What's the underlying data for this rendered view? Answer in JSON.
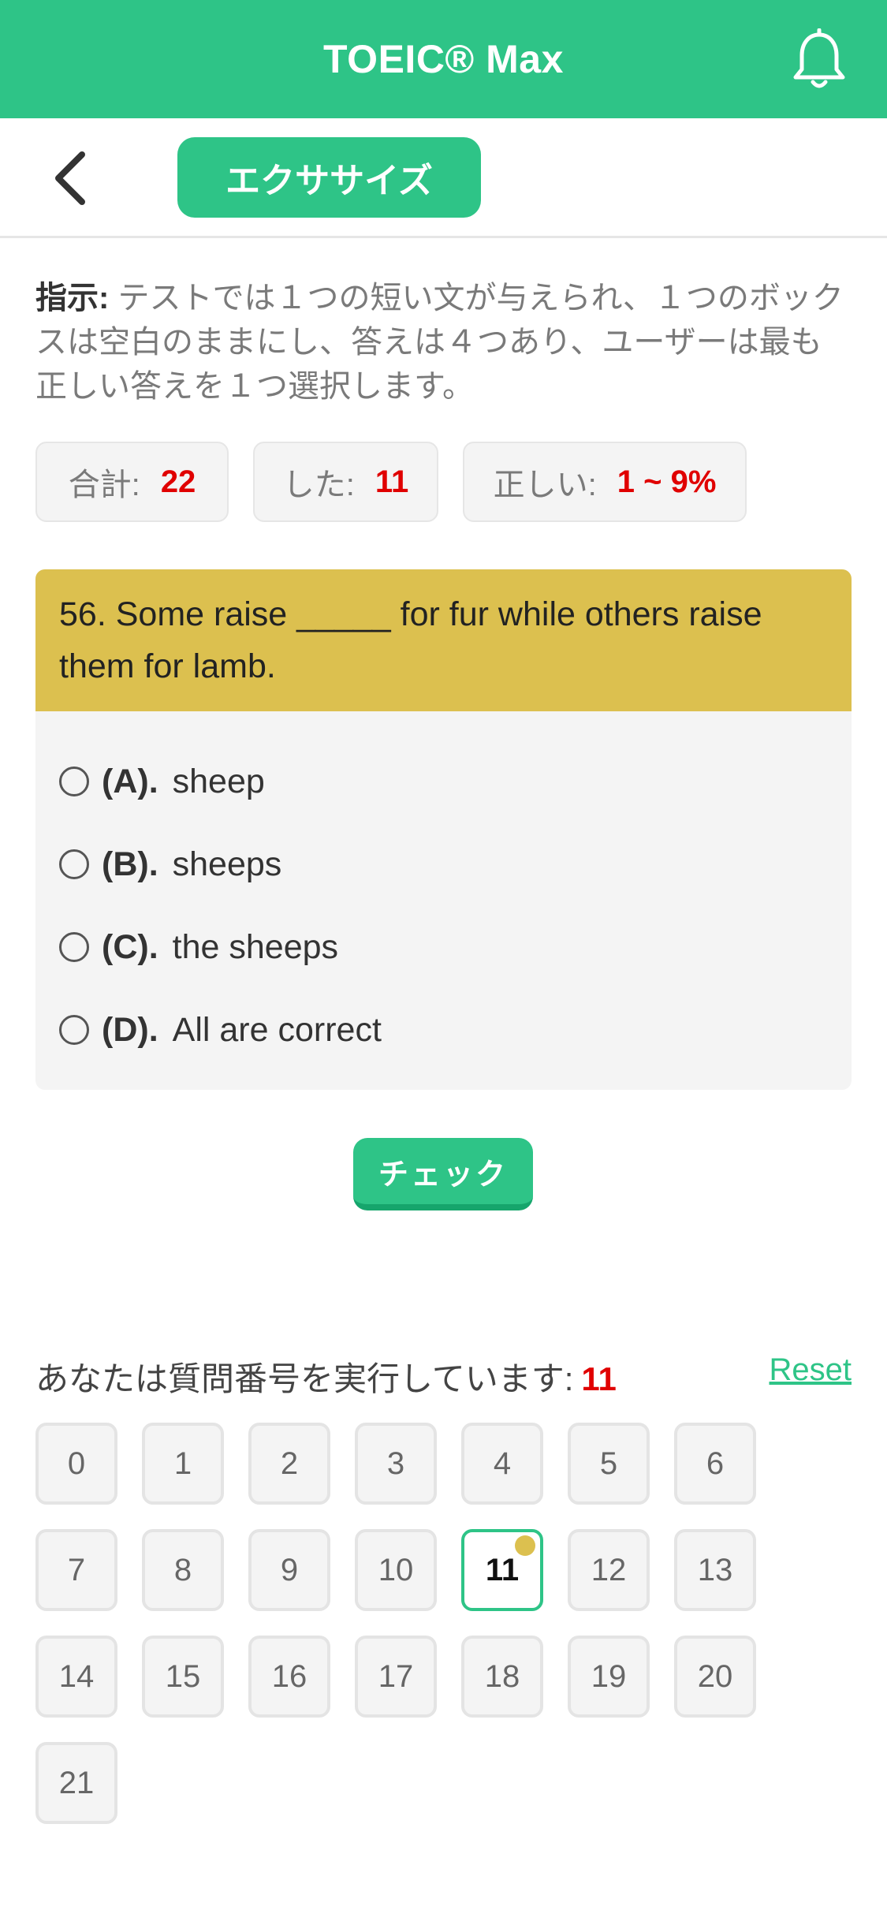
{
  "app": {
    "title": "TOEIC® Max",
    "accent_color": "#2ec487"
  },
  "icons": {
    "bell": "bell-icon",
    "back": "chevron-left-icon"
  },
  "subheader": {
    "tab_label": "エクササイズ"
  },
  "instruction": {
    "label": "指示:",
    "text": " テストでは１つの短い文が与えられ、１つのボックスは空白のままにし、答えは４つあり、ユーザーは最も正しい答えを１つ選択します。"
  },
  "stats": [
    {
      "label": "合計:",
      "value": "22"
    },
    {
      "label": "した:",
      "value": "11"
    },
    {
      "label": "正しい:",
      "value": "1 ~ 9%"
    }
  ],
  "question": {
    "text": "56. Some raise _____ for fur while others raise them for lamb.",
    "highlight_color": "#dcc04f",
    "options": [
      {
        "letter": "(A).",
        "text": "sheep"
      },
      {
        "letter": "(B).",
        "text": "sheeps"
      },
      {
        "letter": "(C).",
        "text": "the sheeps"
      },
      {
        "letter": "(D).",
        "text": "All are correct"
      }
    ]
  },
  "check_button": "チェック",
  "progress": {
    "running_label": "あなたは質問番号を実行しています:",
    "current": "11",
    "reset_label": "Reset",
    "numbers": [
      "0",
      "1",
      "2",
      "3",
      "4",
      "5",
      "6",
      "7",
      "8",
      "9",
      "10",
      "11",
      "12",
      "13",
      "14",
      "15",
      "16",
      "17",
      "18",
      "19",
      "20",
      "21"
    ],
    "active_index": 11
  }
}
